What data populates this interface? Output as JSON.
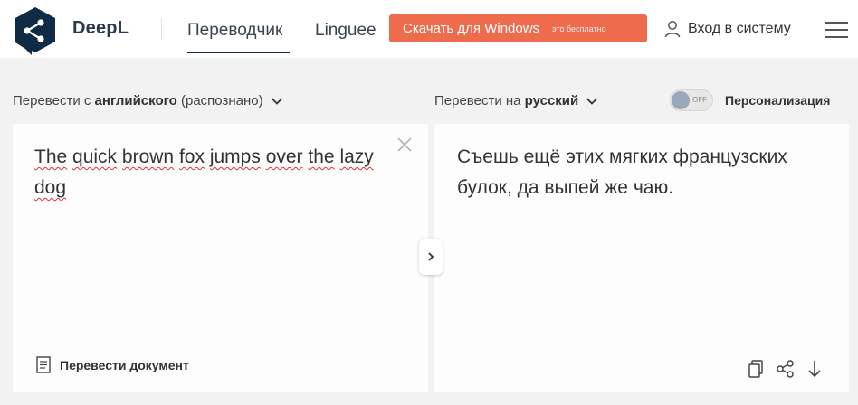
{
  "header": {
    "brand": "DeepL",
    "nav": {
      "translator": "Переводчик",
      "linguee": "Linguee"
    },
    "download_button": {
      "label": "Скачать для Windows",
      "sublabel": "это бесплатно"
    },
    "login": "Вход в систему"
  },
  "language_bar": {
    "source": {
      "prefix": "Перевести с",
      "language": "английского",
      "suffix": "(распознано)"
    },
    "target": {
      "prefix": "Перевести на",
      "language": "русский"
    },
    "toggle_state": "OFF",
    "personalization": "Персонализация"
  },
  "source_panel": {
    "words": [
      "The",
      "quick",
      "brown",
      "fox",
      "jumps",
      "over",
      "the",
      "lazy",
      "dog"
    ],
    "translate_document": "Перевести документ"
  },
  "target_panel": {
    "text": "Съешь ещё этих мягких французских булок, да выпей же чаю."
  },
  "colors": {
    "accent": "#ee6b4d",
    "brand_dark": "#0f2b46",
    "background": "#f2f2f2",
    "panel": "#fdfdfd"
  }
}
